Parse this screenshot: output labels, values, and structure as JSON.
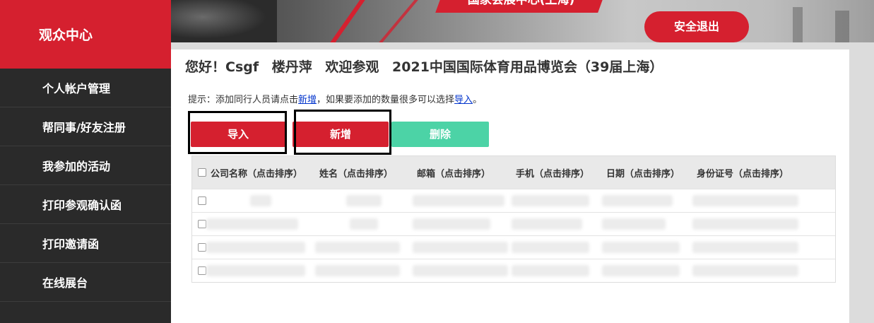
{
  "sidebar": {
    "title": "观众中心",
    "items": [
      {
        "label": "个人帐户管理"
      },
      {
        "label": "帮同事/好友注册"
      },
      {
        "label": "我参加的活动"
      },
      {
        "label": "打印参观确认函"
      },
      {
        "label": "打印邀请函"
      },
      {
        "label": "在线展台"
      }
    ]
  },
  "header": {
    "venue_tag": "国家会展中心(上海)",
    "logout_label": "安全退出"
  },
  "main": {
    "welcome_parts": [
      "您好！Csgf",
      "楼丹萍",
      "欢迎参观",
      "2021中国国际体育用品博览会（39届上海）"
    ],
    "tip_prefix": "提示：添加同行人员请点击",
    "tip_link_add": "新增",
    "tip_middle": "，如果要添加的数量很多可以选择",
    "tip_link_import": "导入",
    "tip_suffix": "。",
    "buttons": {
      "import": "导入",
      "add": "新增",
      "delete": "删除"
    },
    "colors": {
      "brand_red": "#d5202f",
      "delete_green": "#4cd3a6"
    }
  },
  "table": {
    "columns": [
      "公司名称（点击排序）",
      "姓名（点击排序）",
      "邮箱（点击排序）",
      "手机（点击排序）",
      "日期（点击排序）",
      "身份证号（点击排序）"
    ],
    "row_count": 4
  }
}
